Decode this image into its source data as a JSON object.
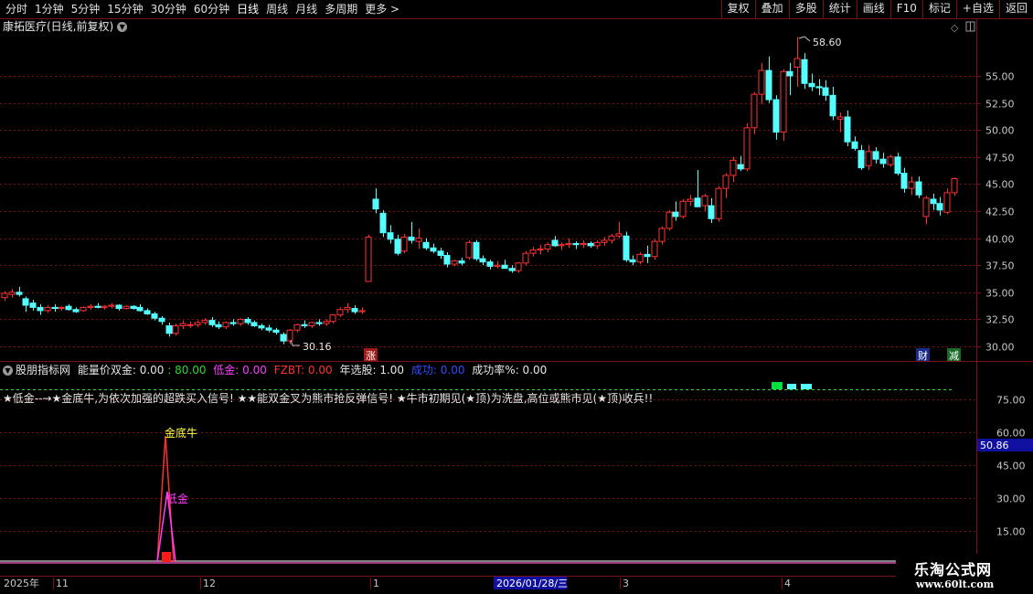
{
  "toolbar": {
    "periods": [
      {
        "label": "分时",
        "active": false
      },
      {
        "label": "1分钟",
        "active": false
      },
      {
        "label": "5分钟",
        "active": false
      },
      {
        "label": "15分钟",
        "active": false
      },
      {
        "label": "30分钟",
        "active": false
      },
      {
        "label": "60分钟",
        "active": false
      },
      {
        "label": "日线",
        "active": true
      },
      {
        "label": "周线",
        "active": false
      },
      {
        "label": "月线",
        "active": false
      },
      {
        "label": "多周期",
        "active": false
      },
      {
        "label": "更多 >",
        "active": false
      }
    ],
    "buttons": [
      "复权",
      "叠加",
      "多股",
      "统计",
      "画线",
      "F10",
      "标记",
      "+自选",
      "返回"
    ]
  },
  "stock": {
    "title": "康拓医疗(日线,前复权)",
    "high_label": "58.60",
    "low_label": "30.16"
  },
  "price_axis": {
    "ticks": [
      "55.00",
      "52.50",
      "50.00",
      "47.50",
      "45.00",
      "42.50",
      "40.00",
      "37.50",
      "35.00",
      "32.50",
      "30.00"
    ]
  },
  "markers": {
    "zhang": "涨",
    "cai": "财",
    "jian": "减"
  },
  "indicator": {
    "name": "股朋指标网",
    "params": [
      {
        "text": "能量价双金: 0.00",
        "color": "#e6e6e6"
      },
      {
        "text": ": 80.00",
        "color": "#2ed62e"
      },
      {
        "text": "低金: 0.00",
        "color": "#ff3cff"
      },
      {
        "text": "FZBT: 0.00",
        "color": "#ff3030"
      },
      {
        "text": "年选股: 1.00",
        "color": "#e6e6e6"
      },
      {
        "text": "成功: 0.00",
        "color": "#2f4cff"
      },
      {
        "text": "成功率%: 0.00",
        "color": "#e6e6e6"
      }
    ],
    "description": "★低金--→★金底牛,为依次加强的超跌买入信号! ★★能双金叉为熊市抢反弹信号! ★牛市初期见(★顶)为洗盘,高位或熊市见(★顶)收兵!!",
    "axis_ticks": [
      "75.00",
      "60.00",
      "45.00",
      "30.00",
      "15.00"
    ],
    "current_value": "50.86",
    "label_gold_bull": "金底牛",
    "label_low_gold": "低金"
  },
  "date_axis": {
    "year": "2025年",
    "months": [
      "11",
      "12",
      "1",
      "3",
      "4"
    ],
    "highlight_date": "2026/01/28/三"
  },
  "brand": {
    "line1": "乐淘公式网",
    "line2": "www.60lt.com"
  },
  "colors": {
    "up": "#ff3232",
    "down": "#54ffff",
    "grid": "#7a1010",
    "axis_text": "#c8c8c8"
  },
  "chart_data": {
    "type": "candlestick",
    "ohlc": [
      [
        34.5,
        35.1,
        34.2,
        34.9
      ],
      [
        34.8,
        35.3,
        34.5,
        35.0
      ],
      [
        35.0,
        35.5,
        34.6,
        34.8
      ],
      [
        34.4,
        34.6,
        33.2,
        33.8
      ],
      [
        34.0,
        34.3,
        33.3,
        33.6
      ],
      [
        33.6,
        33.9,
        32.9,
        33.3
      ],
      [
        33.3,
        33.8,
        33.1,
        33.6
      ],
      [
        33.6,
        33.9,
        33.2,
        33.5
      ],
      [
        33.5,
        33.7,
        33.3,
        33.6
      ],
      [
        33.7,
        33.9,
        33.3,
        33.4
      ],
      [
        33.4,
        33.6,
        33.1,
        33.2
      ],
      [
        33.3,
        33.7,
        33.2,
        33.6
      ],
      [
        33.6,
        33.9,
        33.4,
        33.7
      ],
      [
        33.7,
        34.0,
        33.5,
        33.6
      ],
      [
        33.6,
        33.8,
        33.4,
        33.7
      ],
      [
        33.7,
        34.0,
        33.5,
        33.8
      ],
      [
        33.8,
        33.9,
        33.3,
        33.5
      ],
      [
        33.5,
        33.8,
        33.4,
        33.7
      ],
      [
        33.7,
        33.8,
        33.4,
        33.5
      ],
      [
        33.6,
        33.9,
        33.2,
        33.3
      ],
      [
        33.3,
        33.5,
        32.9,
        33.0
      ],
      [
        33.0,
        33.2,
        32.4,
        32.6
      ],
      [
        32.6,
        32.8,
        32.0,
        32.3
      ],
      [
        31.9,
        32.2,
        30.9,
        31.2
      ],
      [
        31.2,
        32.1,
        31.0,
        31.9
      ],
      [
        31.9,
        32.4,
        31.6,
        32.1
      ],
      [
        32.0,
        32.3,
        31.7,
        32.0
      ],
      [
        32.0,
        32.4,
        31.8,
        32.2
      ],
      [
        32.2,
        32.6,
        32.0,
        32.4
      ],
      [
        32.4,
        32.7,
        31.8,
        32.0
      ],
      [
        32.0,
        32.3,
        31.6,
        31.8
      ],
      [
        31.8,
        32.3,
        31.6,
        32.2
      ],
      [
        32.2,
        32.5,
        31.9,
        32.1
      ],
      [
        32.1,
        32.6,
        31.9,
        32.5
      ],
      [
        32.5,
        32.7,
        32.0,
        32.2
      ],
      [
        32.2,
        32.4,
        31.8,
        31.9
      ],
      [
        31.9,
        32.1,
        31.5,
        31.7
      ],
      [
        31.7,
        32.0,
        31.3,
        31.5
      ],
      [
        31.5,
        31.7,
        31.1,
        31.3
      ],
      [
        31.1,
        31.3,
        30.2,
        30.5
      ],
      [
        30.5,
        31.6,
        30.2,
        31.5
      ],
      [
        31.5,
        32.1,
        31.3,
        32.0
      ],
      [
        32.0,
        32.4,
        31.7,
        31.9
      ],
      [
        31.9,
        32.3,
        31.7,
        32.2
      ],
      [
        32.2,
        32.5,
        31.9,
        32.1
      ],
      [
        32.1,
        32.5,
        31.9,
        32.3
      ],
      [
        32.3,
        33.0,
        32.1,
        32.9
      ],
      [
        32.9,
        33.6,
        32.7,
        33.4
      ],
      [
        33.4,
        34.0,
        33.1,
        33.6
      ],
      [
        33.5,
        33.8,
        33.0,
        33.2
      ],
      [
        33.2,
        33.6,
        33.0,
        33.3
      ],
      [
        36.0,
        40.3,
        36.0,
        40.1
      ],
      [
        43.6,
        44.6,
        42.3,
        42.7
      ],
      [
        42.3,
        42.6,
        40.1,
        40.5
      ],
      [
        40.5,
        41.2,
        39.5,
        39.9
      ],
      [
        39.9,
        40.3,
        38.4,
        38.6
      ],
      [
        38.8,
        40.4,
        38.6,
        40.1
      ],
      [
        40.1,
        41.5,
        39.5,
        39.8
      ],
      [
        39.7,
        40.9,
        39.0,
        40.0
      ],
      [
        39.6,
        40.0,
        38.9,
        39.1
      ],
      [
        39.1,
        39.5,
        38.6,
        38.8
      ],
      [
        38.8,
        39.1,
        38.1,
        38.4
      ],
      [
        38.4,
        38.7,
        37.3,
        37.6
      ],
      [
        37.6,
        38.0,
        37.4,
        37.9
      ],
      [
        37.9,
        38.2,
        37.5,
        37.7
      ],
      [
        38.2,
        39.8,
        38.0,
        39.6
      ],
      [
        39.6,
        39.8,
        37.9,
        38.1
      ],
      [
        38.1,
        38.4,
        37.5,
        37.8
      ],
      [
        37.8,
        38.0,
        37.1,
        37.4
      ],
      [
        37.4,
        37.9,
        37.2,
        37.5
      ],
      [
        37.5,
        38.0,
        37.2,
        37.2
      ],
      [
        37.2,
        37.5,
        36.8,
        37.0
      ],
      [
        37.0,
        37.8,
        36.8,
        37.7
      ],
      [
        37.7,
        38.8,
        37.5,
        38.6
      ],
      [
        38.6,
        39.2,
        38.3,
        38.9
      ],
      [
        38.9,
        39.4,
        38.5,
        39.0
      ],
      [
        39.0,
        39.6,
        38.7,
        39.4
      ],
      [
        39.8,
        40.2,
        39.2,
        39.3
      ],
      [
        39.3,
        39.6,
        38.9,
        39.4
      ],
      [
        39.4,
        40.0,
        39.1,
        39.5
      ],
      [
        39.5,
        39.7,
        39.0,
        39.4
      ],
      [
        39.4,
        39.8,
        39.1,
        39.5
      ],
      [
        39.5,
        39.7,
        39.1,
        39.3
      ],
      [
        39.3,
        39.8,
        39.0,
        39.6
      ],
      [
        39.6,
        40.1,
        39.3,
        39.8
      ],
      [
        39.8,
        40.4,
        39.5,
        40.2
      ],
      [
        40.2,
        41.5,
        40.0,
        40.4
      ],
      [
        40.2,
        40.6,
        37.8,
        38.0
      ],
      [
        38.0,
        38.4,
        37.5,
        37.8
      ],
      [
        37.8,
        38.7,
        37.6,
        38.5
      ],
      [
        38.5,
        39.3,
        37.7,
        38.3
      ],
      [
        38.3,
        39.9,
        38.0,
        39.7
      ],
      [
        39.7,
        41.1,
        39.4,
        40.9
      ],
      [
        40.9,
        42.6,
        40.7,
        42.4
      ],
      [
        42.4,
        43.4,
        41.6,
        42.0
      ],
      [
        42.0,
        43.6,
        41.8,
        43.4
      ],
      [
        43.4,
        44.0,
        43.0,
        43.6
      ],
      [
        43.7,
        46.3,
        42.9,
        42.9
      ],
      [
        43.0,
        44.1,
        42.5,
        43.9
      ],
      [
        43.0,
        43.7,
        41.4,
        41.8
      ],
      [
        41.8,
        44.8,
        41.5,
        44.6
      ],
      [
        44.6,
        46.0,
        43.7,
        45.8
      ],
      [
        45.8,
        47.5,
        45.2,
        47.2
      ],
      [
        46.8,
        47.6,
        46.2,
        46.4
      ],
      [
        46.4,
        50.6,
        46.2,
        50.2
      ],
      [
        50.2,
        53.5,
        49.6,
        53.3
      ],
      [
        53.3,
        56.2,
        52.4,
        55.5
      ],
      [
        55.5,
        56.8,
        52.5,
        52.8
      ],
      [
        52.8,
        53.2,
        49.1,
        49.8
      ],
      [
        49.8,
        55.6,
        49.0,
        55.4
      ],
      [
        55.4,
        56.2,
        53.2,
        55.0
      ],
      [
        55.8,
        58.6,
        54.0,
        56.6
      ],
      [
        56.5,
        57.1,
        53.8,
        54.3
      ],
      [
        54.3,
        55.2,
        53.6,
        54.0
      ],
      [
        54.0,
        54.7,
        53.2,
        53.9
      ],
      [
        53.9,
        54.6,
        52.7,
        53.2
      ],
      [
        53.2,
        54.0,
        50.9,
        51.3
      ],
      [
        51.0,
        51.6,
        49.8,
        51.2
      ],
      [
        51.2,
        51.8,
        48.5,
        48.9
      ],
      [
        48.9,
        49.4,
        48.1,
        48.3
      ],
      [
        48.1,
        48.6,
        46.3,
        46.5
      ],
      [
        46.7,
        48.6,
        46.3,
        48.0
      ],
      [
        48.0,
        48.4,
        46.9,
        47.3
      ],
      [
        47.3,
        47.9,
        46.5,
        46.9
      ],
      [
        46.8,
        47.7,
        46.6,
        47.5
      ],
      [
        47.5,
        47.9,
        45.8,
        46.0
      ],
      [
        46.0,
        46.5,
        44.2,
        44.6
      ],
      [
        44.6,
        45.7,
        44.0,
        45.2
      ],
      [
        45.2,
        45.7,
        43.7,
        44.0
      ],
      [
        42.0,
        43.9,
        41.3,
        43.7
      ],
      [
        43.6,
        44.1,
        42.6,
        43.2
      ],
      [
        43.2,
        43.8,
        42.1,
        42.6
      ],
      [
        42.4,
        44.6,
        42.2,
        44.2
      ],
      [
        44.2,
        45.6,
        43.9,
        45.5
      ]
    ],
    "y_range": [
      29.3,
      58.6
    ],
    "indicator_signal": {
      "bars_from_left": 57,
      "value": 60.0
    }
  }
}
